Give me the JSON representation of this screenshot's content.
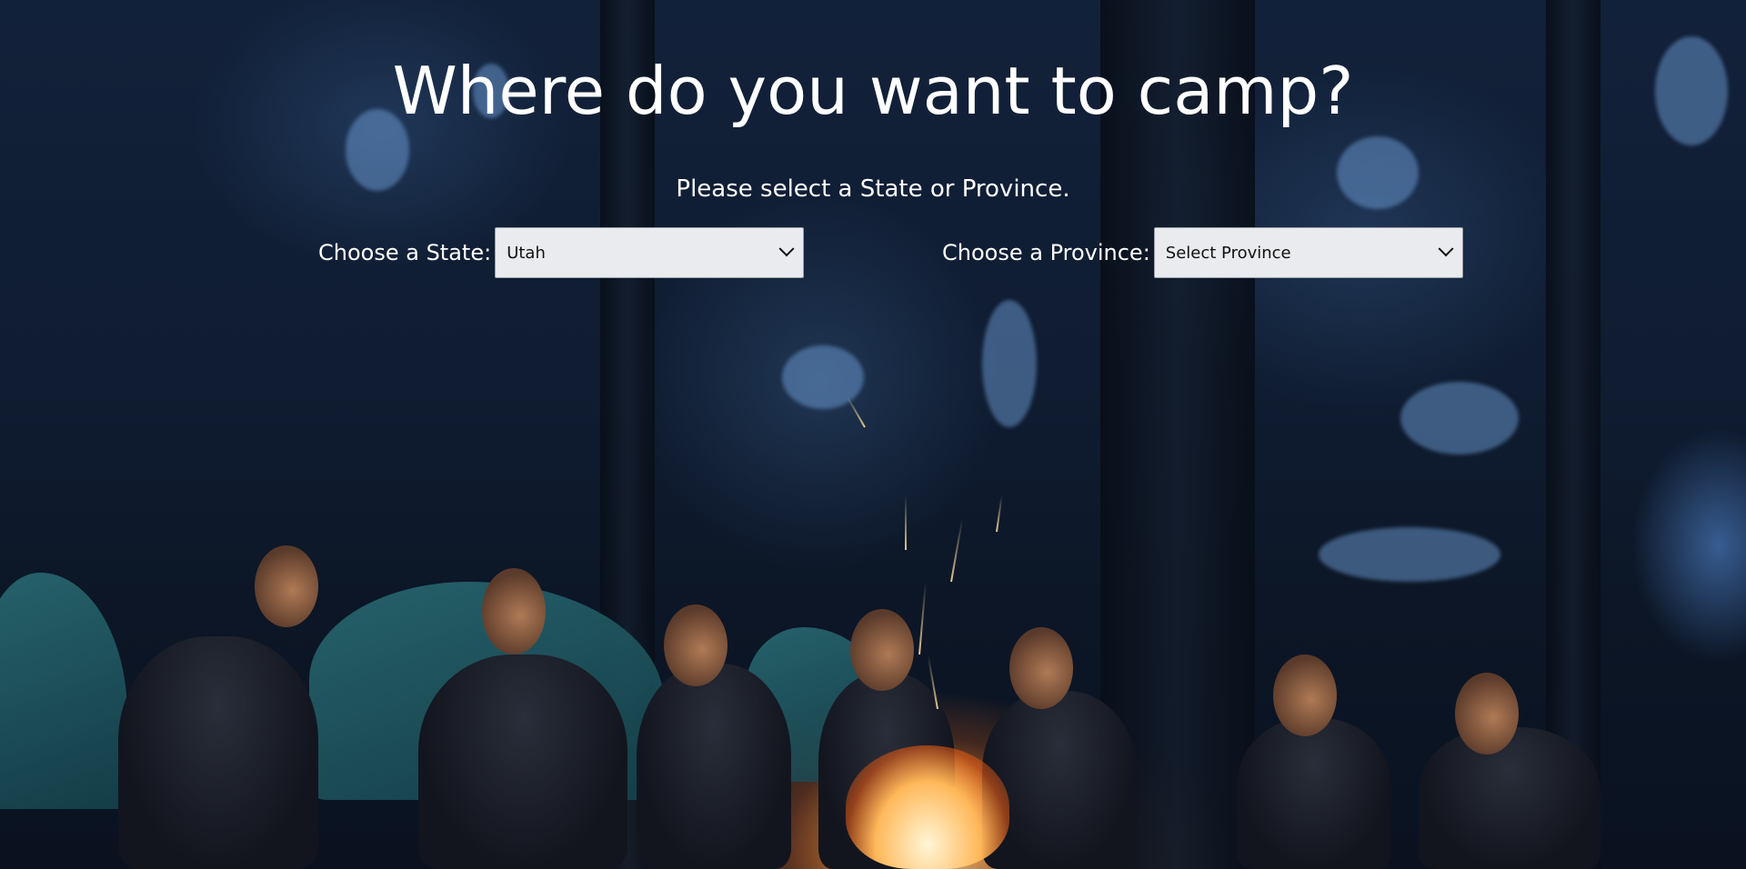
{
  "page": {
    "title": "Where do you want to camp?",
    "subtitle": "Please select a State or Province."
  },
  "state_selector": {
    "label": "Choose a State:",
    "selected": "Utah"
  },
  "province_selector": {
    "label": "Choose a Province:",
    "selected": "Select Province"
  },
  "icons": {
    "state_dropdown": "chevron-down-icon",
    "province_dropdown": "chevron-down-icon"
  },
  "colors": {
    "text": "#ffffff",
    "select_background": "#e9ebee",
    "background_dark": "#0e1a2c"
  }
}
